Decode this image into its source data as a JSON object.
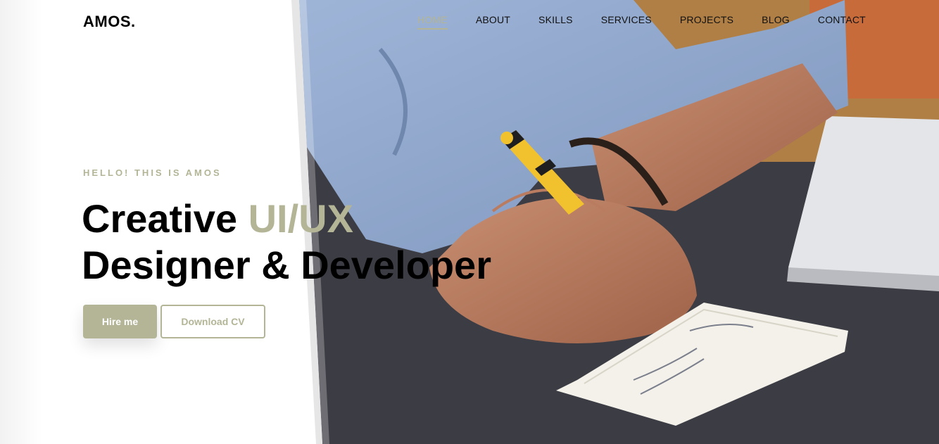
{
  "brand": {
    "logo": "AMOS."
  },
  "nav": {
    "items": [
      {
        "label": "HOME",
        "active": true
      },
      {
        "label": "ABOUT",
        "active": false
      },
      {
        "label": "SKILLS",
        "active": false
      },
      {
        "label": "SERVICES",
        "active": false
      },
      {
        "label": "PROJECTS",
        "active": false
      },
      {
        "label": "BLOG",
        "active": false
      },
      {
        "label": "CONTACT",
        "active": false
      }
    ]
  },
  "hero": {
    "eyebrow": "HELLO! THIS IS AMOS",
    "line1_a": "Creative ",
    "line1_accent": "UI/UX",
    "line2": "Designer & Developer",
    "hire_button": "Hire me",
    "cv_button": "Download CV"
  },
  "colors": {
    "accent": "#b3b596",
    "text": "#000000",
    "background": "#ffffff"
  },
  "icons": {
    "hero_image": "person-writing-with-marker-photo"
  }
}
